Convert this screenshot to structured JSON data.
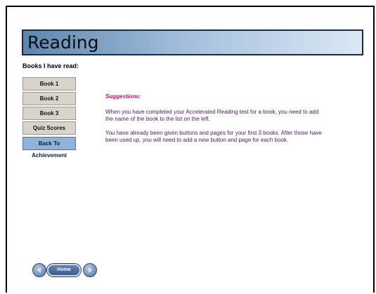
{
  "header": {
    "title": "Reading"
  },
  "sidebar": {
    "label": "Books I have read:",
    "buttons": [
      {
        "label": "Book 1"
      },
      {
        "label": "Book 2"
      },
      {
        "label": "Book 3"
      },
      {
        "label": "Quiz Scores"
      },
      {
        "label": "Back To Achievement"
      }
    ]
  },
  "main": {
    "suggestions_title": "Suggestions:",
    "paragraph1": "When you have completed your Accelerated Reading test for a book, you need to add the name of the book to the list on the left.",
    "paragraph2": "You have already been given buttons and pages for your first 3 books. After those have been used up, you will need to add a new button and page for each book."
  },
  "nav": {
    "home_label": "Home",
    "back_icon": "arrow-left-icon",
    "forward_icon": "arrow-right-icon"
  },
  "colors": {
    "header_gradient_start": "#5e86ad",
    "header_gradient_end": "#dce8f4",
    "suggestion_accent": "#b0157a",
    "body_text": "#4a1a5c",
    "achievement_button": "#8fb3d9"
  }
}
